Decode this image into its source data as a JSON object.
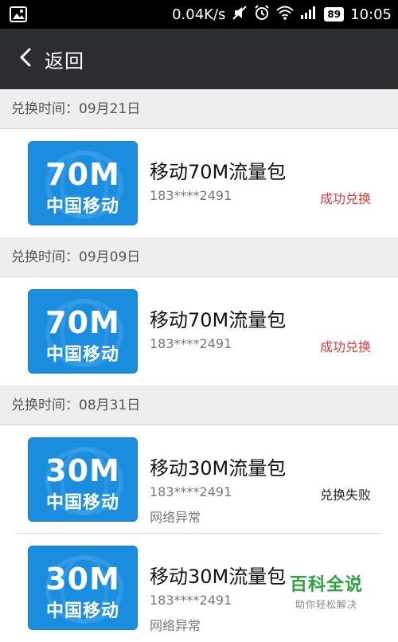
{
  "status_bar": {
    "speed": "0.04K/s",
    "battery": "89",
    "time": "10:05",
    "icons": [
      "gallery-icon",
      "mute-icon",
      "alarm-icon",
      "wifi-icon",
      "signal-icon",
      "battery-icon"
    ]
  },
  "nav": {
    "back_label": "返回"
  },
  "groups": [
    {
      "date_label": "兑换时间：09月21日",
      "items": [
        {
          "thumb_title": "70M",
          "thumb_sub": "中国移动",
          "name": "移动70M流量包",
          "phone": "183****2491",
          "status": "成功兑换",
          "note": ""
        }
      ]
    },
    {
      "date_label": "兑换时间：09月09日",
      "items": [
        {
          "thumb_title": "70M",
          "thumb_sub": "中国移动",
          "name": "移动70M流量包",
          "phone": "183****2491",
          "status": "成功兑换",
          "note": ""
        }
      ]
    },
    {
      "date_label": "兑换时间：08月31日",
      "items": [
        {
          "thumb_title": "30M",
          "thumb_sub": "中国移动",
          "name": "移动30M流量包",
          "phone": "183****2491",
          "status": "兑换失败",
          "note": "网络异常"
        },
        {
          "thumb_title": "30M",
          "thumb_sub": "中国移动",
          "name": "移动30M流量包",
          "phone": "183****2491",
          "status": "",
          "note": "网络异常"
        }
      ]
    }
  ],
  "watermark": {
    "title": "百科全说",
    "subtitle": "助你轻松解决"
  },
  "colors": {
    "nav_bg": "#2c2d31",
    "accent_blue": "#1a8ddf",
    "success_red": "#e03a3a",
    "watermark_green": "#2aa43b"
  }
}
